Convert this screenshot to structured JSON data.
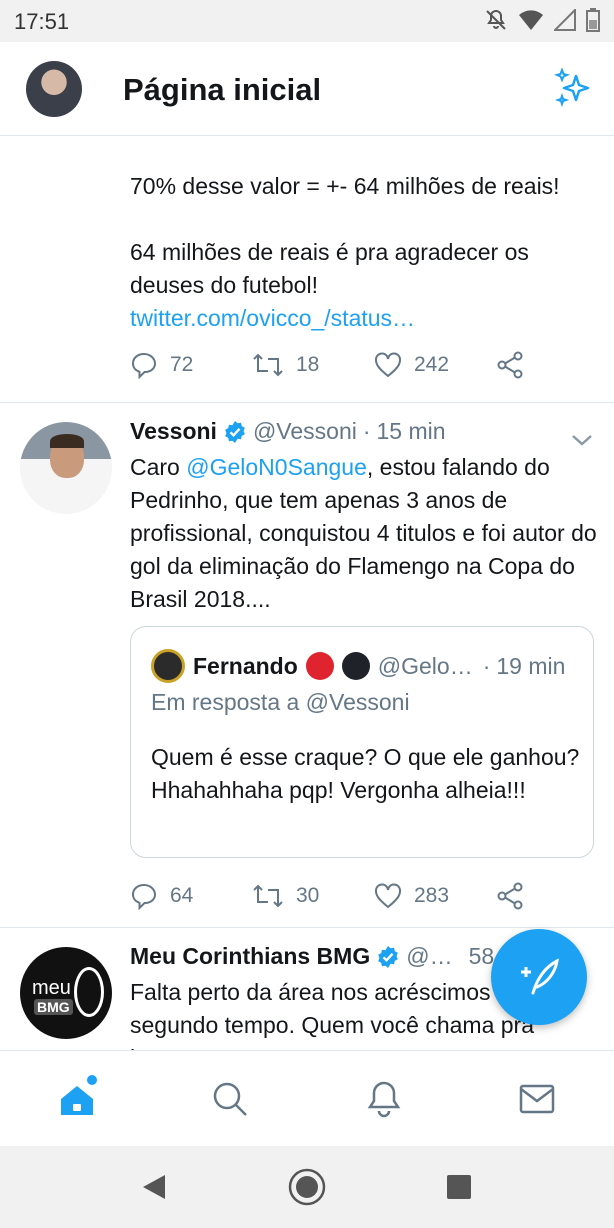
{
  "status_bar": {
    "time": "17:51"
  },
  "header": {
    "title": "Página inicial"
  },
  "tweets": [
    {
      "lines": [
        "70% desse valor = +- 64 milhões de reais!",
        "64 milhões de reais é pra agradecer os deuses do futebol!"
      ],
      "link": "twitter.com/ovicco_/status…",
      "replies": "72",
      "retweets": "18",
      "likes": "242"
    },
    {
      "name": "Vessoni",
      "handle": "@Vessoni",
      "sep": "·",
      "time": "15 min",
      "text_before": "Caro ",
      "mention": "@GeloN0Sangue",
      "text_after": ", estou falando do Pedrinho, que tem apenas 3 anos de profissional, conquistou 4 titulos e foi autor do gol da eliminação do Flamengo na Copa do Brasil 2018....",
      "quote": {
        "name": "Fernando",
        "handle": "@Gelo…",
        "sep": "·",
        "time": "19 min",
        "reply_to": "Em resposta a @Vessoni",
        "text": "Quem é esse craque? O que ele ganhou? Hhahahhaha pqp! Vergonha alheia!!!",
        "dot_colors": [
          "#e0242f",
          "#1f2329"
        ]
      },
      "replies": "64",
      "retweets": "30",
      "likes": "283"
    },
    {
      "name": "Meu Corinthians BMG",
      "handle": "@…",
      "time": "58",
      "avatar_text": {
        "meu": "meu",
        "bmg": "BMG"
      },
      "text": "Falta perto da área nos acréscimos do segundo tempo. Quem você chama pra bater?"
    }
  ],
  "colors": {
    "accent": "#1da1f2",
    "muted": "#657786",
    "text": "#14171a"
  }
}
